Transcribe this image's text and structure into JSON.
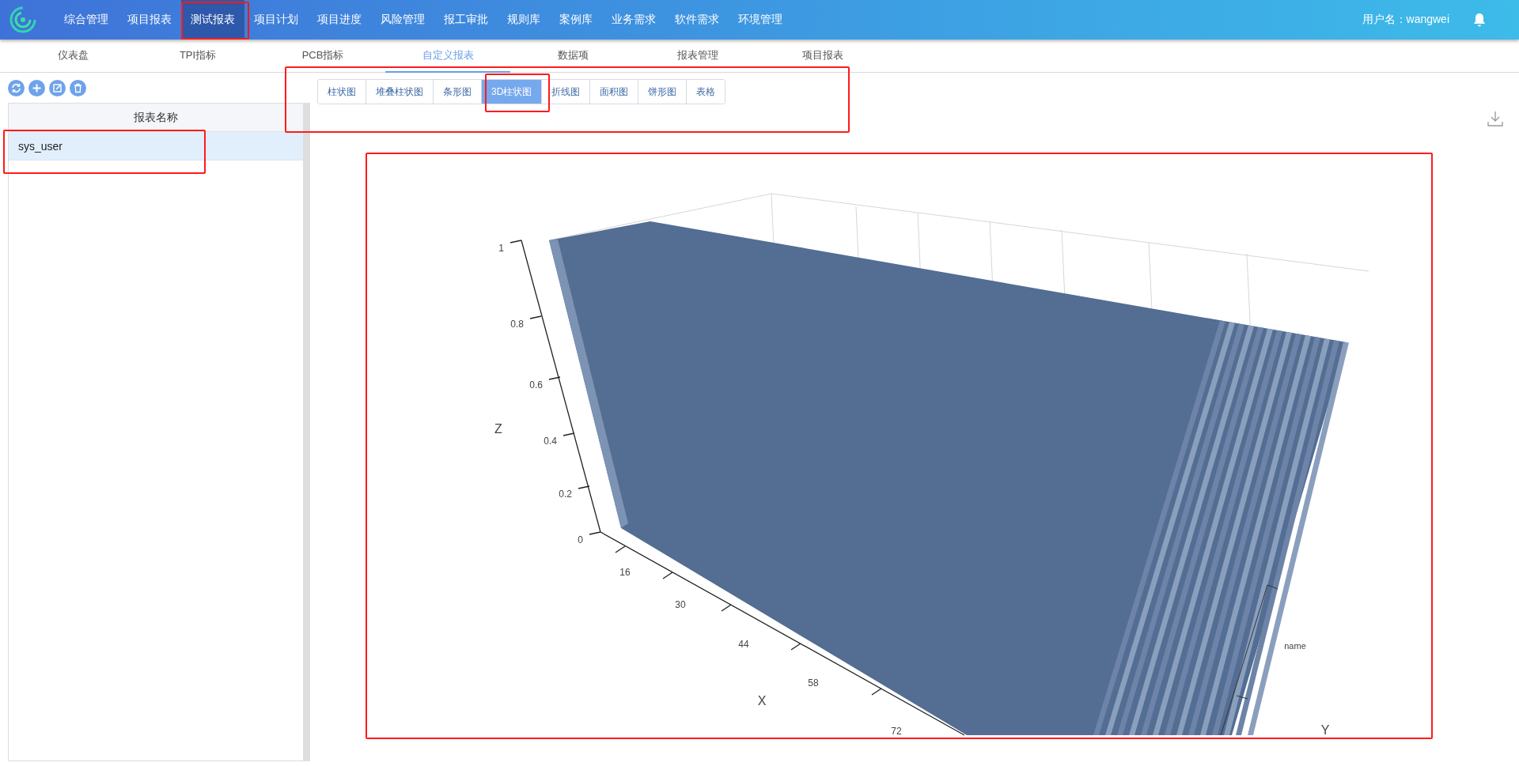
{
  "topbar": {
    "menu": [
      {
        "label": "综合管理",
        "selected": false
      },
      {
        "label": "项目报表",
        "selected": false
      },
      {
        "label": "测试报表",
        "selected": true
      },
      {
        "label": "项目计划",
        "selected": false
      },
      {
        "label": "项目进度",
        "selected": false
      },
      {
        "label": "风险管理",
        "selected": false
      },
      {
        "label": "报工审批",
        "selected": false
      },
      {
        "label": "规则库",
        "selected": false
      },
      {
        "label": "案例库",
        "selected": false
      },
      {
        "label": "业务需求",
        "selected": false
      },
      {
        "label": "软件需求",
        "selected": false
      },
      {
        "label": "环境管理",
        "selected": false
      }
    ],
    "user": "用户名：wangwei"
  },
  "subnav": [
    {
      "label": "仪表盘",
      "selected": false
    },
    {
      "label": "TPI指标",
      "selected": false
    },
    {
      "label": "PCB指标",
      "selected": false
    },
    {
      "label": "自定义报表",
      "selected": true
    },
    {
      "label": "数据项",
      "selected": false
    },
    {
      "label": "报表管理",
      "selected": false
    },
    {
      "label": "项目报表",
      "selected": false
    }
  ],
  "report_list": {
    "header": "报表名称",
    "rows": [
      {
        "name": "sys_user",
        "selected": true
      }
    ]
  },
  "chart_types": [
    {
      "label": "柱状图",
      "selected": false
    },
    {
      "label": "堆叠柱状图",
      "selected": false
    },
    {
      "label": "条形图",
      "selected": false
    },
    {
      "label": "3D柱状图",
      "selected": true
    },
    {
      "label": "折线图",
      "selected": false
    },
    {
      "label": "面积图",
      "selected": false
    },
    {
      "label": "饼形图",
      "selected": false
    },
    {
      "label": "表格",
      "selected": false
    }
  ],
  "chart": {
    "z_label": "Z",
    "x_label": "X",
    "y_label": "Y",
    "z_ticks": [
      "1",
      "0.8",
      "0.6",
      "0.4",
      "0.2",
      "0"
    ],
    "x_ticks": [
      "16",
      "30",
      "44",
      "58",
      "72"
    ],
    "y_ticks": [
      "name"
    ]
  }
}
